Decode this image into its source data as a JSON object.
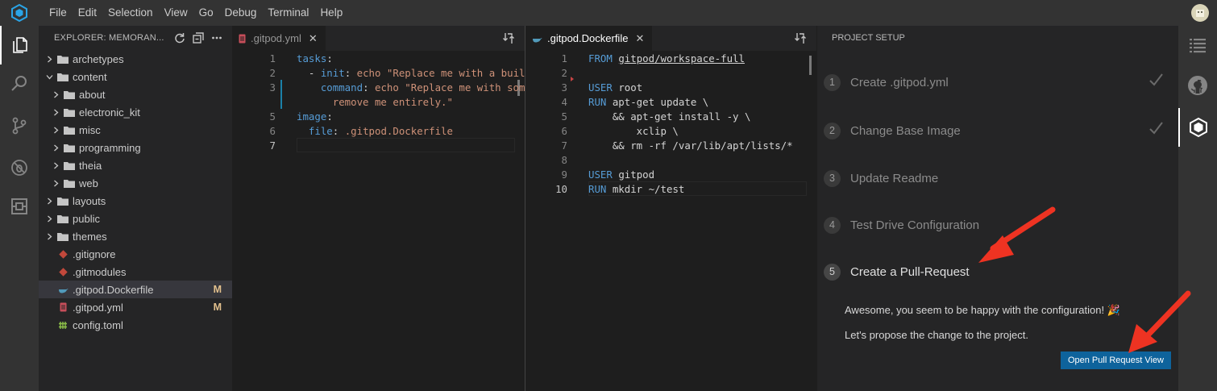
{
  "menubar": {
    "items": [
      "File",
      "Edit",
      "Selection",
      "View",
      "Go",
      "Debug",
      "Terminal",
      "Help"
    ]
  },
  "activity_bar": {
    "icons": [
      "files-icon",
      "search-icon",
      "source-control-icon",
      "debug-icon",
      "extensions-icon"
    ]
  },
  "right_bar": {
    "icons": [
      "list-icon",
      "github-icon",
      "gitpod-icon"
    ]
  },
  "explorer": {
    "title": "EXPLORER: MEMORAN...",
    "items": [
      {
        "label": "archetypes",
        "type": "folder",
        "depth": 0,
        "expanded": false,
        "badge": ""
      },
      {
        "label": "content",
        "type": "folder",
        "depth": 0,
        "expanded": true,
        "badge": ""
      },
      {
        "label": "about",
        "type": "folder",
        "depth": 1,
        "expanded": false,
        "badge": ""
      },
      {
        "label": "electronic_kit",
        "type": "folder",
        "depth": 1,
        "expanded": false,
        "badge": ""
      },
      {
        "label": "misc",
        "type": "folder",
        "depth": 1,
        "expanded": false,
        "badge": ""
      },
      {
        "label": "programming",
        "type": "folder",
        "depth": 1,
        "expanded": false,
        "badge": ""
      },
      {
        "label": "theia",
        "type": "folder",
        "depth": 1,
        "expanded": false,
        "badge": ""
      },
      {
        "label": "web",
        "type": "folder",
        "depth": 1,
        "expanded": false,
        "badge": ""
      },
      {
        "label": "layouts",
        "type": "folder",
        "depth": 0,
        "expanded": false,
        "badge": ""
      },
      {
        "label": "public",
        "type": "folder",
        "depth": 0,
        "expanded": false,
        "badge": ""
      },
      {
        "label": "themes",
        "type": "folder",
        "depth": 0,
        "expanded": false,
        "badge": ""
      },
      {
        "label": ".gitignore",
        "type": "git",
        "depth": 0,
        "badge": ""
      },
      {
        "label": ".gitmodules",
        "type": "git",
        "depth": 0,
        "badge": ""
      },
      {
        "label": ".gitpod.Dockerfile",
        "type": "docker",
        "depth": 0,
        "badge": "M",
        "selected": true
      },
      {
        "label": ".gitpod.yml",
        "type": "yaml",
        "depth": 0,
        "badge": "M"
      },
      {
        "label": "config.toml",
        "type": "toml",
        "depth": 0,
        "badge": ""
      }
    ]
  },
  "editor_left": {
    "tab_label": ".gitpod.yml",
    "lines": [
      {
        "n": "1",
        "parts": [
          [
            "k",
            "tasks"
          ],
          [
            "p",
            ":"
          ]
        ]
      },
      {
        "n": "2",
        "parts": [
          [
            "p",
            "  - "
          ],
          [
            "k",
            "init"
          ],
          [
            "p",
            ": "
          ],
          [
            "s",
            "echo \"Replace me with a build"
          ]
        ]
      },
      {
        "n": "3",
        "parts": [
          [
            "p",
            "    "
          ],
          [
            "k",
            "command"
          ],
          [
            "p",
            ": "
          ],
          [
            "s",
            "echo \"Replace me with some"
          ]
        ]
      },
      {
        "n": "",
        "parts": [
          [
            "s",
            "      remove me entirely.\""
          ]
        ]
      },
      {
        "n": "5",
        "parts": [
          [
            "k",
            "image"
          ],
          [
            "p",
            ":"
          ]
        ]
      },
      {
        "n": "6",
        "parts": [
          [
            "p",
            "  "
          ],
          [
            "k",
            "file"
          ],
          [
            "p",
            ": "
          ],
          [
            "s",
            ".gitpod.Dockerfile"
          ]
        ]
      },
      {
        "n": "7",
        "parts": []
      }
    ]
  },
  "editor_right": {
    "tab_label": ".gitpod.Dockerfile",
    "lines": [
      {
        "n": "1",
        "parts": [
          [
            "k",
            "FROM "
          ],
          [
            "u",
            "gitpod/workspace-full"
          ]
        ]
      },
      {
        "n": "2",
        "parts": []
      },
      {
        "n": "3",
        "parts": [
          [
            "k",
            "USER "
          ],
          [
            "p",
            "root"
          ]
        ]
      },
      {
        "n": "4",
        "parts": [
          [
            "k",
            "RUN "
          ],
          [
            "p",
            "apt-get update \\"
          ]
        ]
      },
      {
        "n": "5",
        "parts": [
          [
            "p",
            "    && apt-get install -y \\"
          ]
        ]
      },
      {
        "n": "6",
        "parts": [
          [
            "p",
            "        xclip \\"
          ]
        ]
      },
      {
        "n": "7",
        "parts": [
          [
            "p",
            "    && rm -rf /var/lib/apt/lists/*"
          ]
        ]
      },
      {
        "n": "8",
        "parts": []
      },
      {
        "n": "9",
        "parts": [
          [
            "k",
            "USER "
          ],
          [
            "p",
            "gitpod"
          ]
        ]
      },
      {
        "n": "10",
        "parts": [
          [
            "k",
            "RUN "
          ],
          [
            "p",
            "mkdir ~/test"
          ]
        ]
      }
    ]
  },
  "setup": {
    "title": "PROJECT SETUP",
    "steps": [
      {
        "num": "1",
        "label": "Create .gitpod.yml",
        "done": true
      },
      {
        "num": "2",
        "label": "Change Base Image",
        "done": true
      },
      {
        "num": "3",
        "label": "Update Readme",
        "done": false
      },
      {
        "num": "4",
        "label": "Test Drive Configuration",
        "done": false
      },
      {
        "num": "5",
        "label": "Create a Pull-Request",
        "done": false,
        "active": true
      }
    ],
    "message1": "Awesome, you seem to be happy with the configuration! 🎉",
    "message2": "Let's propose the change to the project.",
    "button_label": "Open Pull Request View"
  },
  "colors": {
    "accent": "#0e639c",
    "modified": "#e2c08d",
    "keyword": "#569cd6",
    "string": "#ce9178",
    "annotation_arrow": "#ee3322"
  }
}
